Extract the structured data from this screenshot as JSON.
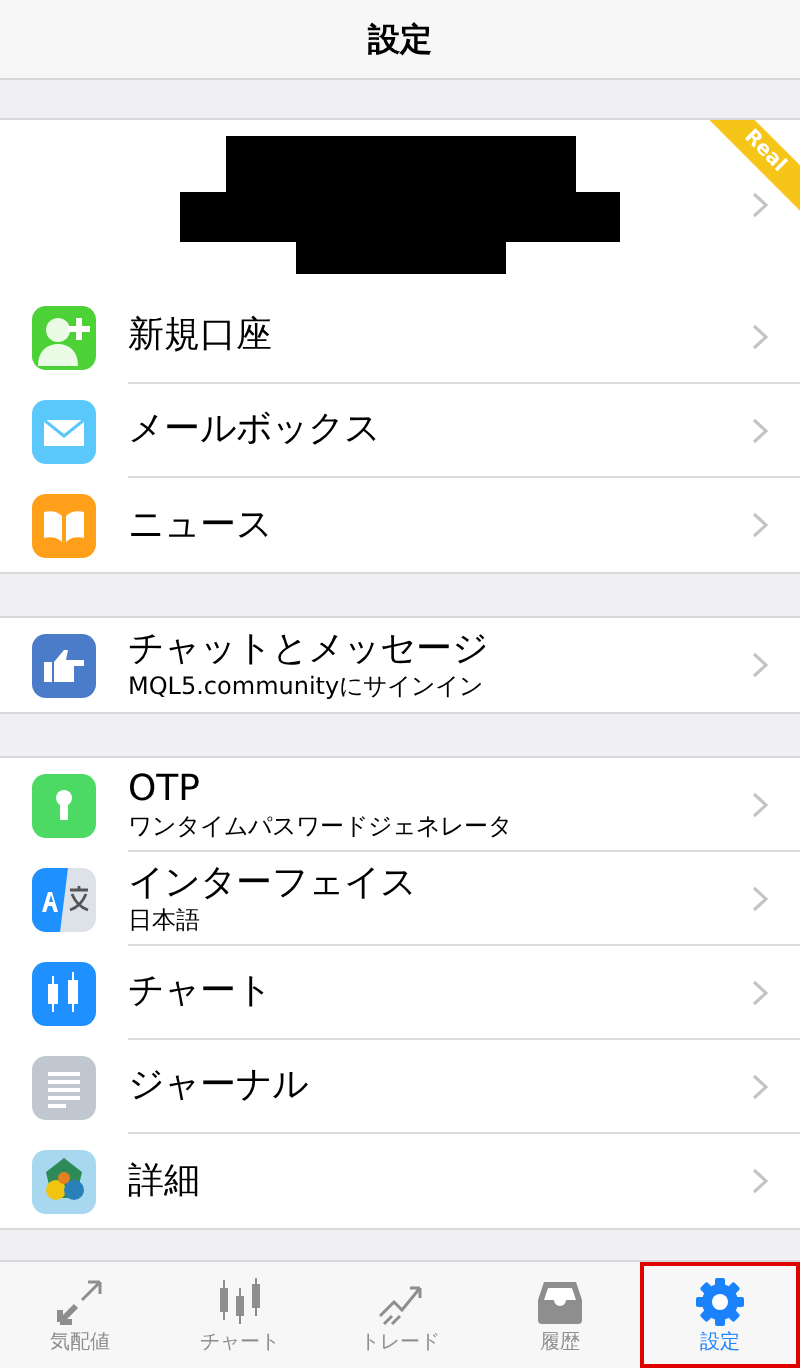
{
  "header": {
    "title": "設定"
  },
  "account": {
    "badge": "Real",
    "redacted": true
  },
  "sections": [
    {
      "items": [
        {
          "kind": "person",
          "label": "新規口座"
        },
        {
          "kind": "mail",
          "label": "メールボックス"
        },
        {
          "kind": "book",
          "label": "ニュース"
        }
      ]
    },
    {
      "items": [
        {
          "kind": "hand",
          "label": "チャットとメッセージ",
          "subtitle": "MQL5.communityにサインイン"
        }
      ]
    },
    {
      "items": [
        {
          "kind": "key",
          "label": "OTP",
          "subtitle": "ワンタイムパスワードジェネレータ"
        },
        {
          "kind": "translate",
          "label": "インターフェイス",
          "subtitle": "日本語"
        },
        {
          "kind": "candles",
          "label": "チャート"
        },
        {
          "kind": "lines",
          "label": "ジャーナル"
        },
        {
          "kind": "logo",
          "label": "詳細"
        }
      ]
    }
  ],
  "tabs": [
    {
      "kind": "arrows",
      "label": "気配値",
      "selected": false
    },
    {
      "kind": "candles",
      "label": "チャート",
      "selected": false
    },
    {
      "kind": "trend",
      "label": "トレード",
      "selected": false
    },
    {
      "kind": "inbox",
      "label": "履歴",
      "selected": false
    },
    {
      "kind": "gear",
      "label": "設定",
      "selected": true
    }
  ]
}
